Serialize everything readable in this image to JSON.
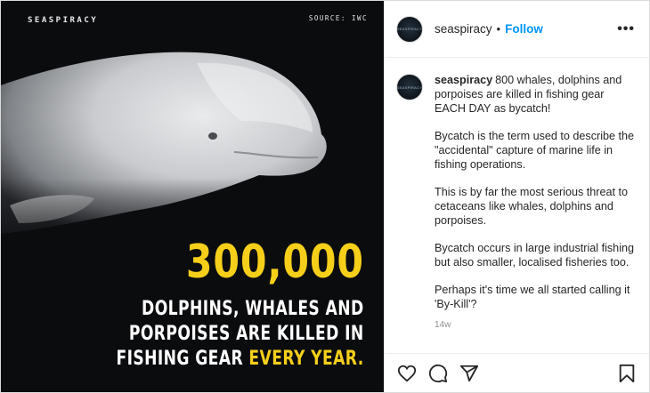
{
  "image": {
    "brand": "SEASPIRACY",
    "source": "SOURCE: IWC",
    "big_number": "300,000",
    "caption_line1": "DOLPHINS, WHALES AND",
    "caption_line2": "PORPOISES ARE KILLED IN",
    "caption_line3_prefix": "FISHING GEAR ",
    "caption_line3_highlight": "EVERY YEAR.",
    "accent_color": "#f5cf1a",
    "background_color": "#0b0c0e"
  },
  "header": {
    "avatar_text": "SEASPIRACY",
    "username": "seaspiracy",
    "separator": "•",
    "follow_label": "Follow",
    "more_label": "•••"
  },
  "post": {
    "author": "seaspiracy",
    "paragraph1": "800 whales, dolphins and porpoises are killed in fishing gear EACH DAY as bycatch!",
    "paragraph2": "Bycatch is the term used to describe the \"accidental\" capture of marine life in fishing operations.",
    "paragraph3": "This is by far the most serious threat to cetaceans like whales, dolphins and porpoises.",
    "paragraph4": "Bycatch occurs in large industrial fishing but also smaller, localised fisheries too.",
    "paragraph5": "Perhaps it's time we all started calling it 'By-Kill'?",
    "time": "14w"
  },
  "actions": {
    "icons": [
      "heart-icon",
      "comment-icon",
      "share-icon",
      "bookmark-icon"
    ]
  },
  "colors": {
    "link": "#0095f6",
    "text": "#262626",
    "muted": "#8e8e8e"
  }
}
